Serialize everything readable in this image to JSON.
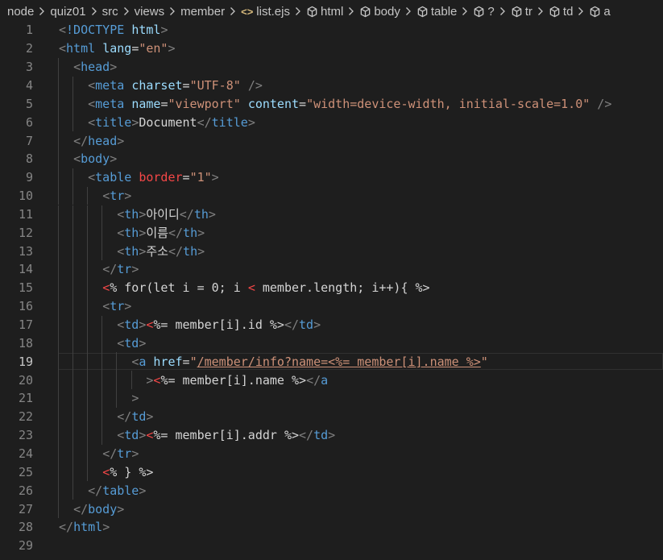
{
  "breadcrumb": {
    "items": [
      "node",
      "quiz01",
      "src",
      "views",
      "member",
      "list.ejs",
      "html",
      "body",
      "table",
      "?",
      "tr",
      "td",
      "a"
    ],
    "file_icon": "<>"
  },
  "editor": {
    "current_line": 19,
    "line_numbers": [
      "1",
      "2",
      "3",
      "4",
      "5",
      "6",
      "7",
      "8",
      "9",
      "10",
      "11",
      "12",
      "13",
      "14",
      "15",
      "16",
      "17",
      "18",
      "19",
      "20",
      "21",
      "22",
      "23",
      "24",
      "25",
      "26",
      "27",
      "28",
      "29"
    ],
    "lines": [
      [
        [
          "t-br",
          "<"
        ],
        [
          "t-doc",
          "!DOCTYPE "
        ],
        [
          "t-attr",
          "html"
        ],
        [
          "t-br",
          ">"
        ]
      ],
      [
        [
          "t-br",
          "<"
        ],
        [
          "t-tag",
          "html "
        ],
        [
          "t-attr",
          "lang"
        ],
        [
          "t-white",
          "="
        ],
        [
          "t-val",
          "\"en\""
        ],
        [
          "t-br",
          ">"
        ]
      ],
      [
        [
          "t-white",
          "  "
        ],
        [
          "t-br",
          "<"
        ],
        [
          "t-tag",
          "head"
        ],
        [
          "t-br",
          ">"
        ]
      ],
      [
        [
          "t-white",
          "    "
        ],
        [
          "t-br",
          "<"
        ],
        [
          "t-tag",
          "meta "
        ],
        [
          "t-attr",
          "charset"
        ],
        [
          "t-white",
          "="
        ],
        [
          "t-val",
          "\"UTF-8\""
        ],
        [
          "t-white",
          " "
        ],
        [
          "t-br",
          "/>"
        ]
      ],
      [
        [
          "t-white",
          "    "
        ],
        [
          "t-br",
          "<"
        ],
        [
          "t-tag",
          "meta "
        ],
        [
          "t-attr",
          "name"
        ],
        [
          "t-white",
          "="
        ],
        [
          "t-val",
          "\"viewport\""
        ],
        [
          "t-white",
          " "
        ],
        [
          "t-attr",
          "content"
        ],
        [
          "t-white",
          "="
        ],
        [
          "t-val",
          "\"width=device-width, initial-scale=1.0\""
        ],
        [
          "t-white",
          " "
        ],
        [
          "t-br",
          "/>"
        ]
      ],
      [
        [
          "t-white",
          "    "
        ],
        [
          "t-br",
          "<"
        ],
        [
          "t-tag",
          "title"
        ],
        [
          "t-br",
          ">"
        ],
        [
          "t-text",
          "Document"
        ],
        [
          "t-br",
          "</"
        ],
        [
          "t-tag",
          "title"
        ],
        [
          "t-br",
          ">"
        ]
      ],
      [
        [
          "t-white",
          "  "
        ],
        [
          "t-br",
          "</"
        ],
        [
          "t-tag",
          "head"
        ],
        [
          "t-br",
          ">"
        ]
      ],
      [
        [
          "t-white",
          "  "
        ],
        [
          "t-br",
          "<"
        ],
        [
          "t-tag",
          "body"
        ],
        [
          "t-br",
          ">"
        ]
      ],
      [
        [
          "t-white",
          "    "
        ],
        [
          "t-br",
          "<"
        ],
        [
          "t-tag",
          "table "
        ],
        [
          "t-red-attr",
          "border"
        ],
        [
          "t-white",
          "="
        ],
        [
          "t-val",
          "\"1\""
        ],
        [
          "t-br",
          ">"
        ]
      ],
      [
        [
          "t-white",
          "      "
        ],
        [
          "t-br",
          "<"
        ],
        [
          "t-tag",
          "tr"
        ],
        [
          "t-br",
          ">"
        ]
      ],
      [
        [
          "t-white",
          "        "
        ],
        [
          "t-br",
          "<"
        ],
        [
          "t-tag",
          "th"
        ],
        [
          "t-br",
          ">"
        ],
        [
          "t-text",
          "아이디"
        ],
        [
          "t-br",
          "</"
        ],
        [
          "t-tag",
          "th"
        ],
        [
          "t-br",
          ">"
        ]
      ],
      [
        [
          "t-white",
          "        "
        ],
        [
          "t-br",
          "<"
        ],
        [
          "t-tag",
          "th"
        ],
        [
          "t-br",
          ">"
        ],
        [
          "t-text",
          "이름"
        ],
        [
          "t-br",
          "</"
        ],
        [
          "t-tag",
          "th"
        ],
        [
          "t-br",
          ">"
        ]
      ],
      [
        [
          "t-white",
          "        "
        ],
        [
          "t-br",
          "<"
        ],
        [
          "t-tag",
          "th"
        ],
        [
          "t-br",
          ">"
        ],
        [
          "t-text",
          "주소"
        ],
        [
          "t-br",
          "</"
        ],
        [
          "t-tag",
          "th"
        ],
        [
          "t-br",
          ">"
        ]
      ],
      [
        [
          "t-white",
          "      "
        ],
        [
          "t-br",
          "</"
        ],
        [
          "t-tag",
          "tr"
        ],
        [
          "t-br",
          ">"
        ]
      ],
      [
        [
          "t-white",
          "      "
        ],
        [
          "t-ejs",
          "<"
        ],
        [
          "t-white",
          "% for(let i = 0; i "
        ],
        [
          "t-ejs",
          "<"
        ],
        [
          "t-white",
          " member.length; i++){ %>"
        ]
      ],
      [
        [
          "t-white",
          "      "
        ],
        [
          "t-br",
          "<"
        ],
        [
          "t-tag",
          "tr"
        ],
        [
          "t-br",
          ">"
        ]
      ],
      [
        [
          "t-white",
          "        "
        ],
        [
          "t-br",
          "<"
        ],
        [
          "t-tag",
          "td"
        ],
        [
          "t-br",
          ">"
        ],
        [
          "t-ejs",
          "<"
        ],
        [
          "t-white",
          "%= member[i].id %>"
        ],
        [
          "t-br",
          "</"
        ],
        [
          "t-tag",
          "td"
        ],
        [
          "t-br",
          ">"
        ]
      ],
      [
        [
          "t-white",
          "        "
        ],
        [
          "t-br",
          "<"
        ],
        [
          "t-tag",
          "td"
        ],
        [
          "t-br",
          ">"
        ]
      ],
      [
        [
          "t-white",
          "          "
        ],
        [
          "t-br",
          "<"
        ],
        [
          "t-tag",
          "a "
        ],
        [
          "t-attr",
          "href"
        ],
        [
          "t-white",
          "="
        ],
        [
          "t-val",
          "\""
        ],
        [
          "t-val underline",
          "/member/info?name=<%= member[i].name %>"
        ],
        [
          "t-val",
          "\""
        ]
      ],
      [
        [
          "t-white",
          "            "
        ],
        [
          "t-br",
          ">"
        ],
        [
          "t-ejs",
          "<"
        ],
        [
          "t-white",
          "%= member[i].name %>"
        ],
        [
          "t-br",
          "</"
        ],
        [
          "t-tag",
          "a"
        ]
      ],
      [
        [
          "t-white",
          "          "
        ],
        [
          "t-br",
          ">"
        ]
      ],
      [
        [
          "t-white",
          "        "
        ],
        [
          "t-br",
          "</"
        ],
        [
          "t-tag",
          "td"
        ],
        [
          "t-br",
          ">"
        ]
      ],
      [
        [
          "t-white",
          "        "
        ],
        [
          "t-br",
          "<"
        ],
        [
          "t-tag",
          "td"
        ],
        [
          "t-br",
          ">"
        ],
        [
          "t-ejs",
          "<"
        ],
        [
          "t-white",
          "%= member[i].addr %>"
        ],
        [
          "t-br",
          "</"
        ],
        [
          "t-tag",
          "td"
        ],
        [
          "t-br",
          ">"
        ]
      ],
      [
        [
          "t-white",
          "      "
        ],
        [
          "t-br",
          "</"
        ],
        [
          "t-tag",
          "tr"
        ],
        [
          "t-br",
          ">"
        ]
      ],
      [
        [
          "t-white",
          "      "
        ],
        [
          "t-ejs",
          "<"
        ],
        [
          "t-white",
          "% } %>"
        ]
      ],
      [
        [
          "t-white",
          "    "
        ],
        [
          "t-br",
          "</"
        ],
        [
          "t-tag",
          "table"
        ],
        [
          "t-br",
          ">"
        ]
      ],
      [
        [
          "t-white",
          "  "
        ],
        [
          "t-br",
          "</"
        ],
        [
          "t-tag",
          "body"
        ],
        [
          "t-br",
          ">"
        ]
      ],
      [
        [
          "t-br",
          "</"
        ],
        [
          "t-tag",
          "html"
        ],
        [
          "t-br",
          ">"
        ]
      ],
      []
    ]
  },
  "colors": {
    "background": "#1e1e1e",
    "tag": "#569cd6",
    "attribute": "#9cdcfe",
    "string": "#ce9178",
    "ejs_delimiter": "#f44747",
    "line_number": "#858585"
  }
}
